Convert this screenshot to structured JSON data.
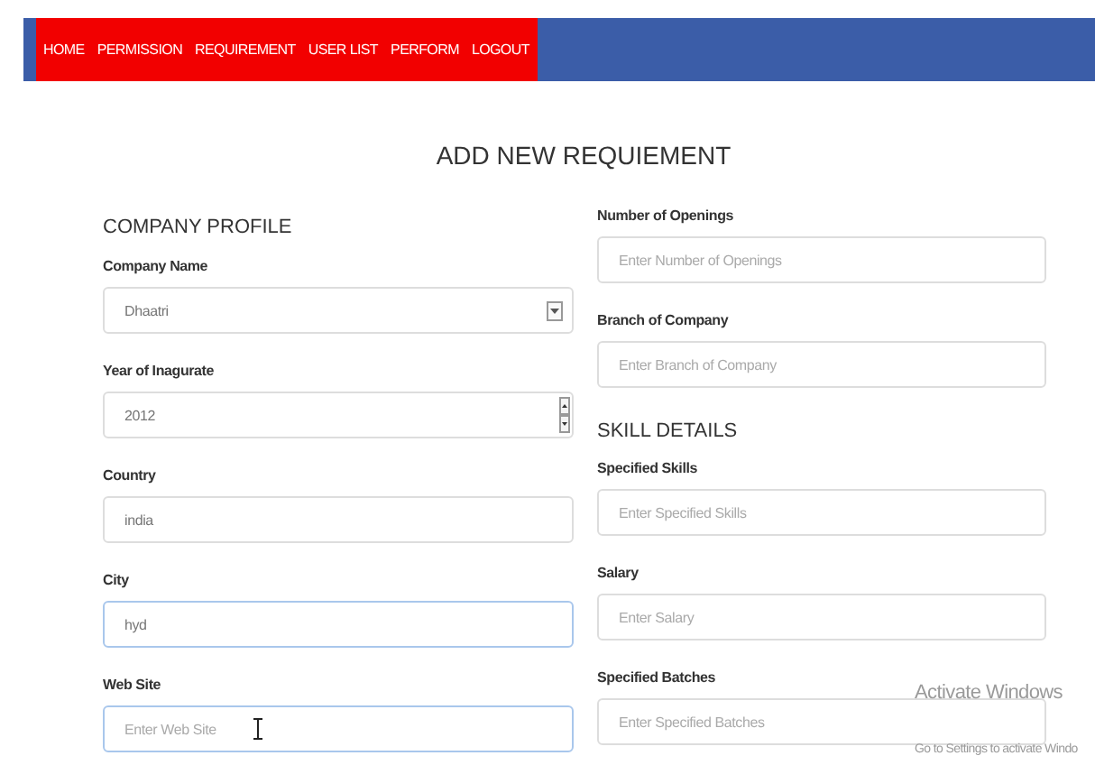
{
  "nav": {
    "items": [
      {
        "label": "HOME"
      },
      {
        "label": "PERMISSION"
      },
      {
        "label": "REQUIREMENT"
      },
      {
        "label": "USER LIST"
      },
      {
        "label": "PERFORM"
      },
      {
        "label": "LOGOUT"
      }
    ]
  },
  "title": "ADD NEW REQUIEMENT",
  "columns": [
    [
      {
        "kind": "heading",
        "text": "COMPANY PROFILE"
      },
      {
        "kind": "select",
        "label": "Company Name",
        "value": "Dhaatri",
        "focused": false
      },
      {
        "kind": "number",
        "label": "Year of Inagurate",
        "value": "2012",
        "focused": false
      },
      {
        "kind": "text",
        "label": "Country",
        "value": "india",
        "focused": false
      },
      {
        "kind": "text",
        "label": "City",
        "value": "hyd",
        "focused": true
      },
      {
        "kind": "text",
        "label": "Web Site",
        "placeholder": "Enter Web Site",
        "focused": true,
        "cursor": true
      }
    ],
    [
      {
        "kind": "text",
        "label": "Number of Openings",
        "placeholder": "Enter Number of Openings",
        "focused": false
      },
      {
        "kind": "text",
        "label": "Branch of Company",
        "placeholder": "Enter Branch of Company",
        "focused": false
      },
      {
        "kind": "heading",
        "text": "SKILL DETAILS"
      },
      {
        "kind": "text",
        "label": "Specified Skills",
        "placeholder": "Enter Specified Skills",
        "focused": false
      },
      {
        "kind": "text",
        "label": "Salary",
        "placeholder": "Enter Salary",
        "focused": false
      },
      {
        "kind": "text",
        "label": "Specified Batches",
        "placeholder": "Enter Specified Batches",
        "focused": false
      }
    ]
  ],
  "os_notice": {
    "title": "Activate Windows",
    "text": "Go to Settings to activate Windo"
  }
}
